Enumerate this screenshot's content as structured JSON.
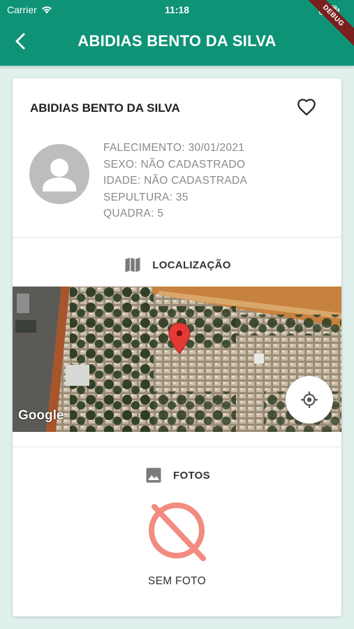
{
  "status_bar": {
    "carrier": "Carrier",
    "time": "11:18"
  },
  "app_bar": {
    "title": "ABIDIAS BENTO DA SILVA",
    "debug_label": "DEBUG",
    "color": "#0f9377"
  },
  "profile": {
    "name": "ABIDIAS BENTO DA SILVA",
    "details": [
      "FALECIMENTO: 30/01/2021",
      "SEXO: NÃO CADASTRADO",
      "IDADE:  NÃO CADASTRADA",
      "SEPULTURA:  35",
      "QUADRA:  5"
    ],
    "favorite_icon": "heart-outline-icon",
    "avatar_icon": "person-icon"
  },
  "location": {
    "title": "LOCALIZAÇÃO",
    "icon": "map-icon",
    "map_attribution": "Google",
    "marker_icon": "map-pin-icon",
    "locate_icon": "my-location-icon"
  },
  "photos": {
    "title": "FOTOS",
    "icon": "image-icon",
    "empty_icon": "no-photo-icon",
    "empty_label": "SEM FOTO",
    "empty_color": "#f28b80"
  }
}
